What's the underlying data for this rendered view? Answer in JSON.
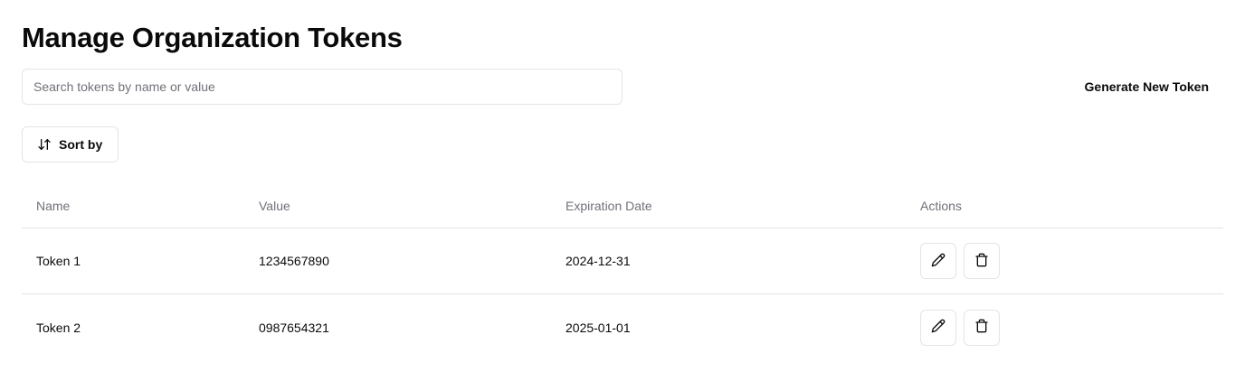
{
  "header": {
    "title": "Manage Organization Tokens"
  },
  "search": {
    "placeholder": "Search tokens by name or value",
    "value": ""
  },
  "toolbar": {
    "generate_label": "Generate New Token",
    "sort_label": "Sort by",
    "sort_icon": "arrow-up-down-icon"
  },
  "table": {
    "columns": [
      "Name",
      "Value",
      "Expiration Date",
      "Actions"
    ],
    "rows": [
      {
        "name": "Token 1",
        "value": "1234567890",
        "expiration": "2024-12-31",
        "actions": [
          "pencil-icon",
          "trash-icon"
        ]
      },
      {
        "name": "Token 2",
        "value": "0987654321",
        "expiration": "2025-01-01",
        "actions": [
          "pencil-icon",
          "trash-icon"
        ]
      }
    ]
  },
  "colors": {
    "border": "#e4e4e7",
    "muted_text": "#71717a",
    "text": "#0a0a0a"
  }
}
